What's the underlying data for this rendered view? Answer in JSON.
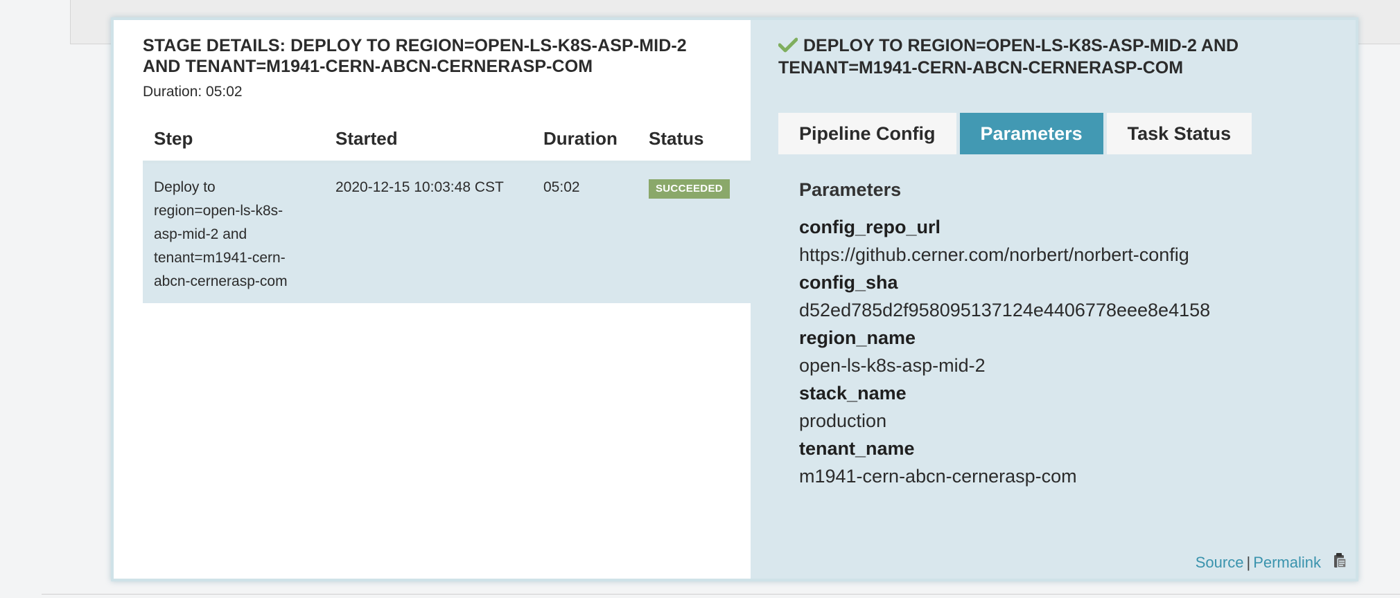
{
  "stage": {
    "title": "STAGE DETAILS: DEPLOY TO REGION=OPEN-LS-K8S-ASP-MID-2 AND TENANT=M1941-CERN-ABCN-CERNERASP-COM",
    "duration_text": "Duration: 05:02"
  },
  "steps_table": {
    "headers": [
      "Step",
      "Started",
      "Duration",
      "Status"
    ],
    "rows": [
      {
        "step": "Deploy to region=open-ls-k8s-asp-mid-2 and tenant=m1941-cern-abcn-cernerasp-com",
        "started": "2020-12-15 10:03:48 CST",
        "duration": "05:02",
        "status": "SUCCEEDED"
      }
    ]
  },
  "detail": {
    "title": "DEPLOY TO REGION=OPEN-LS-K8S-ASP-MID-2 AND TENANT=M1941-CERN-ABCN-CERNERASP-COM",
    "status_icon": "checkmark-icon",
    "tabs": [
      {
        "label": "Pipeline Config",
        "active": false
      },
      {
        "label": "Parameters",
        "active": true
      },
      {
        "label": "Task Status",
        "active": false
      }
    ],
    "params_heading": "Parameters",
    "params": [
      {
        "key": "config_repo_url",
        "value": "https://github.cerner.com/norbert/norbert-config"
      },
      {
        "key": "config_sha",
        "value": "d52ed785d2f958095137124e4406778eee8e4158"
      },
      {
        "key": "region_name",
        "value": "open-ls-k8s-asp-mid-2"
      },
      {
        "key": "stack_name",
        "value": "production"
      },
      {
        "key": "tenant_name",
        "value": "m1941-cern-abcn-cernerasp-com"
      }
    ]
  },
  "footer": {
    "source_label": "Source",
    "separator": "|",
    "permalink_label": "Permalink",
    "copy_icon": "clipboard-icon"
  },
  "colors": {
    "accent": "#4299b3",
    "panel_bg": "#d9e7ed",
    "success": "#8aa86a",
    "link": "#3a93ad"
  }
}
